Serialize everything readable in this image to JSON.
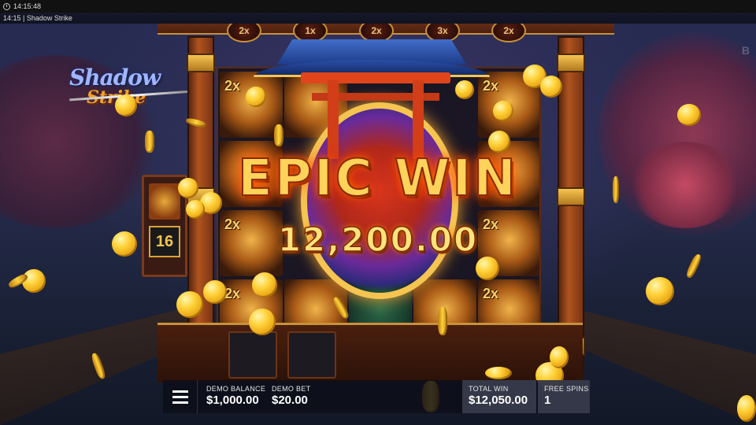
{
  "status_bar": {
    "time": "14:15:48"
  },
  "window": {
    "title": "14:15 | Shadow Strike"
  },
  "logo": {
    "line1": "Shadow",
    "line2": "Strike"
  },
  "side_panel": {
    "counter": "16"
  },
  "reel_multipliers": [
    "2x",
    "1x",
    "2x",
    "3x",
    "2x"
  ],
  "symbol_multiplier": "2x",
  "win_banner": {
    "title": "EPIC WIN",
    "amount": "12,200.00"
  },
  "hud": {
    "balance_label": "DEMO BALANCE",
    "balance_value": "$1,000.00",
    "bet_label": "DEMO BET",
    "bet_value": "$20.00",
    "total_win_label": "TOTAL WIN",
    "total_win_value": "$12,050.00",
    "free_spins_label": "FREE SPINS",
    "free_spins_value": "1"
  },
  "corner_mark": "B",
  "colors": {
    "gold": "#ffd35a",
    "frame": "#7d3b1d",
    "roof": "#2a4fa8",
    "hud_bg": "#0c0e18"
  }
}
